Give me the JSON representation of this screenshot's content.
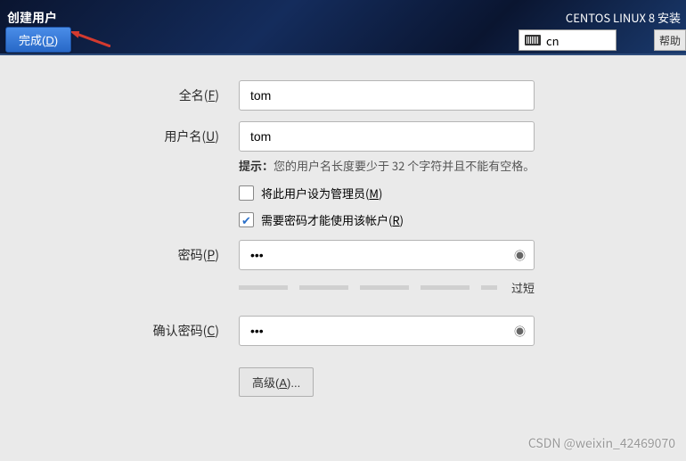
{
  "header": {
    "title": "创建用户",
    "brand": "CENTOS LINUX 8 安装",
    "done_prefix": "完成(",
    "done_key": "D",
    "done_suffix": ")",
    "keyboard_layout": "cn",
    "help_label": "帮助"
  },
  "form": {
    "fullname_label_pre": "全名(",
    "fullname_key": "F",
    "fullname_label_post": ")",
    "fullname_value": "tom",
    "username_label_pre": "用户名(",
    "username_key": "U",
    "username_label_post": ")",
    "username_value": "tom",
    "hint_prefix": "提示：",
    "hint_text": "您的用户名长度要少于 32 个字符并且不能有空格。",
    "admin_checked": false,
    "admin_label_pre": "将此用户设为管理员(",
    "admin_key": "M",
    "admin_label_post": ")",
    "require_pwd_checked": true,
    "require_pwd_label_pre": "需要密码才能使用该帐户(",
    "require_pwd_key": "R",
    "require_pwd_label_post": ")",
    "password_label_pre": "密码(",
    "password_key": "P",
    "password_label_post": ")",
    "password_value": "•••",
    "strength_text": "过短",
    "confirm_label_pre": "确认密码(",
    "confirm_key": "C",
    "confirm_label_post": ")",
    "confirm_value": "•••",
    "advanced_label_pre": "高级(",
    "advanced_key": "A",
    "advanced_label_post": ")..."
  },
  "footer": {
    "watermark": "CSDN @weixin_42469070",
    "page": ""
  }
}
